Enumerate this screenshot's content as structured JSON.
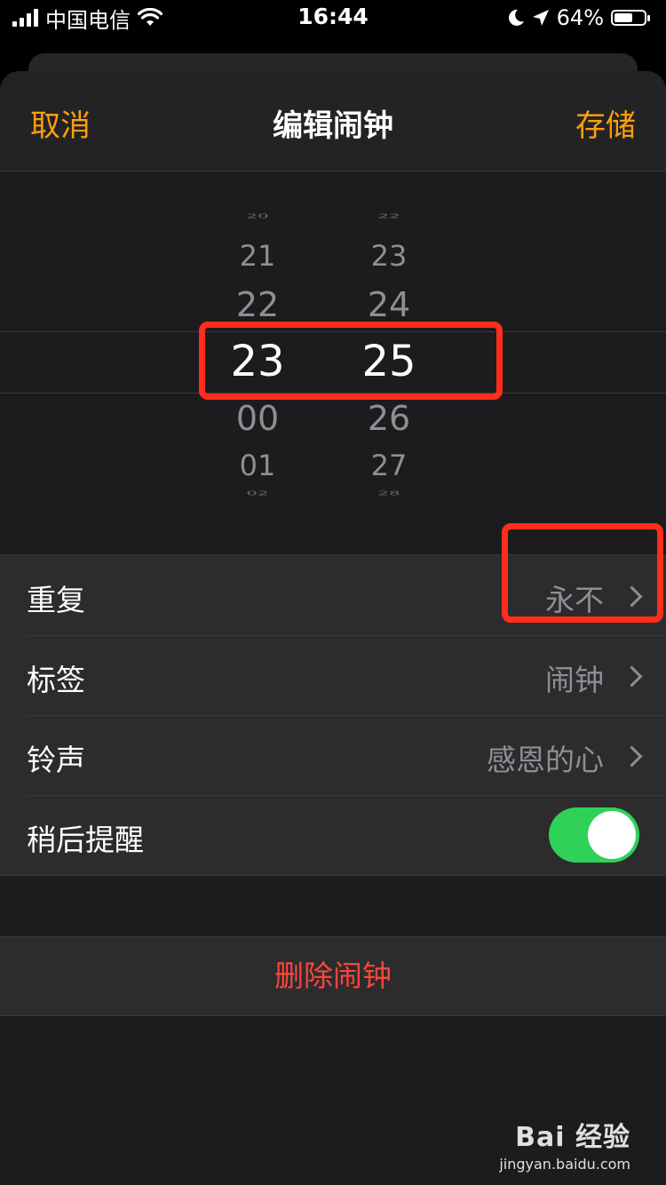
{
  "status_bar": {
    "carrier": "中国电信",
    "time": "16:44",
    "battery": "64%",
    "battery_level": 0.64
  },
  "nav": {
    "cancel_label": "取消",
    "title": "编辑闹钟",
    "save_label": "存储"
  },
  "picker": {
    "hours": [
      "20",
      "21",
      "22",
      "23",
      "00",
      "01",
      "02"
    ],
    "minutes": [
      "22",
      "23",
      "24",
      "25",
      "26",
      "27",
      "28"
    ],
    "selected_hour": "23",
    "selected_minute": "25"
  },
  "settings": [
    {
      "label": "重复",
      "value": "永不"
    },
    {
      "label": "标签",
      "value": "闹钟"
    },
    {
      "label": "铃声",
      "value": "感恩的心"
    },
    {
      "label": "稍后提醒",
      "toggle": true
    }
  ],
  "delete_label": "删除闹钟",
  "watermark": {
    "brand": "Bai 经验",
    "url": "jingyan.baidu.com"
  },
  "colors": {
    "accent": "#ff9f0a",
    "destructive": "#ff453a",
    "toggle_on": "#30d158",
    "highlight": "#ff2d1a"
  }
}
